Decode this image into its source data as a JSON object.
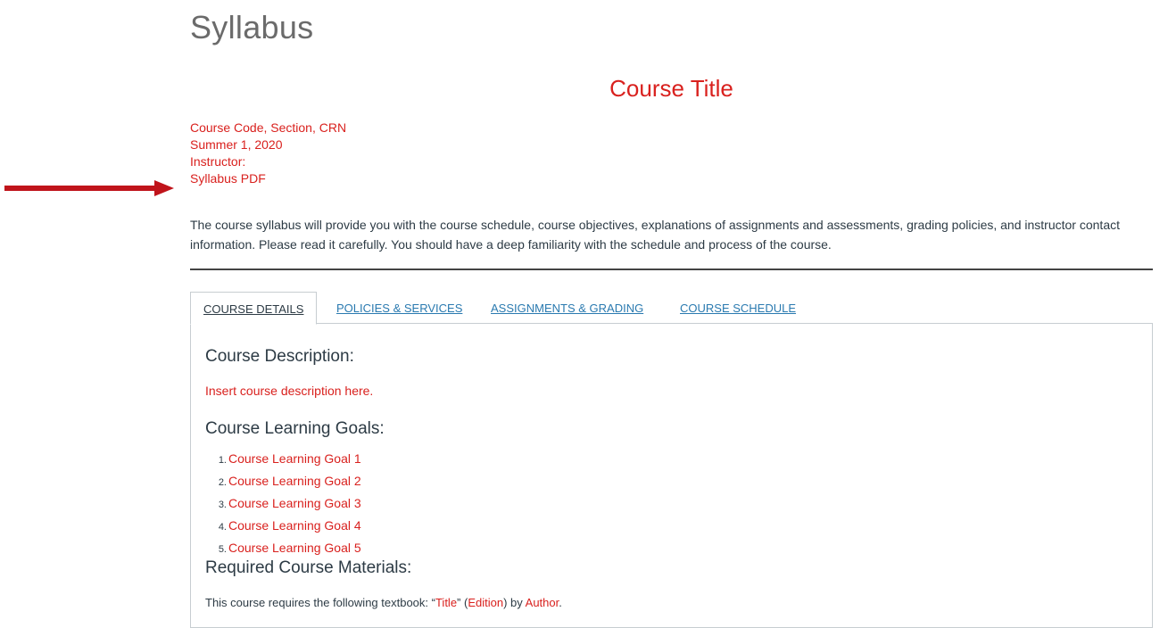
{
  "page": {
    "title": "Syllabus"
  },
  "course": {
    "title": "Course Title",
    "code_line": "Course Code, Section, CRN",
    "term": "Summer 1, 2020",
    "instructor_label": "Instructor:",
    "syllabus_pdf_link": "Syllabus PDF",
    "intro": "The course syllabus will provide you with the course schedule, course objectives, explanations of assignments and assessments, grading policies, and instructor contact information. Please read it carefully. You should have a deep familiarity with the schedule and process of the course."
  },
  "colors": {
    "accent": "#d9211e",
    "link": "#2a7ab0",
    "text": "#2d3b45",
    "arrow": "#c0141b"
  },
  "tabs": [
    {
      "label": "COURSE DETAILS",
      "active": true
    },
    {
      "label": "POLICIES & SERVICES",
      "active": false
    },
    {
      "label": "ASSIGNMENTS & GRADING",
      "active": false
    },
    {
      "label": "COURSE SCHEDULE",
      "active": false
    }
  ],
  "details": {
    "description_heading": "Course Description:",
    "description_text": "Insert course description here.",
    "goals_heading": "Course Learning Goals:",
    "goals": [
      {
        "num": "1.",
        "text": "Course Learning Goal 1"
      },
      {
        "num": "2.",
        "text": "Course Learning Goal 2"
      },
      {
        "num": "3.",
        "text": "Course Learning Goal 3"
      },
      {
        "num": "4.",
        "text": "Course Learning Goal 4"
      },
      {
        "num": "5.",
        "text": "Course Learning Goal 5"
      }
    ],
    "materials_heading": "Required Course Materials:",
    "materials": {
      "prefix": "This course requires the following textbook: “",
      "title": "Title",
      "mid1": "” (",
      "edition": "Edition",
      "mid2": ") by ",
      "author": "Author",
      "suffix": "."
    }
  },
  "annotation": {
    "icon": "right-arrow-icon"
  }
}
